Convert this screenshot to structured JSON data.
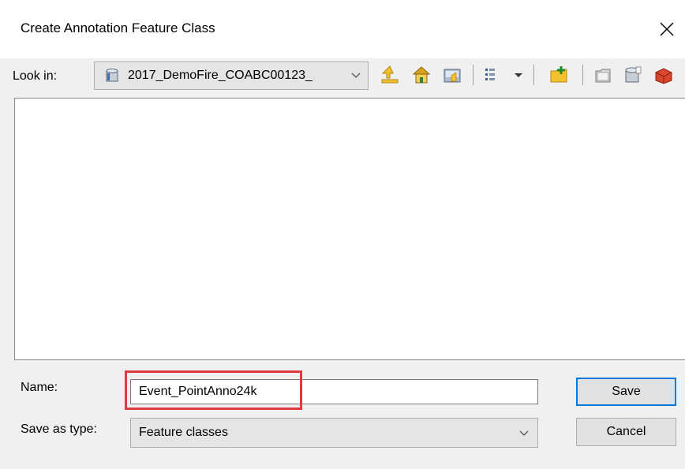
{
  "window": {
    "title": "Create Annotation Feature Class",
    "close_glyph": "✕"
  },
  "lookin": {
    "label": "Look in:",
    "value": "2017_DemoFire_COABC00123_",
    "icon": "database-icon"
  },
  "toolbar": {
    "icons": [
      "up-one-level-icon",
      "home-icon",
      "connect-folder-icon",
      "view-menu-icon",
      "new-folder-icon",
      "new-file-icon",
      "new-database-icon",
      "toolbox-icon"
    ]
  },
  "name": {
    "label": "Name:",
    "value": "Event_PointAnno24k"
  },
  "save_as_type": {
    "label": "Save as type:",
    "value": "Feature classes"
  },
  "buttons": {
    "save": "Save",
    "cancel": "Cancel"
  },
  "colors": {
    "highlight": "#e0393e",
    "default_button_border": "#0078d7"
  }
}
